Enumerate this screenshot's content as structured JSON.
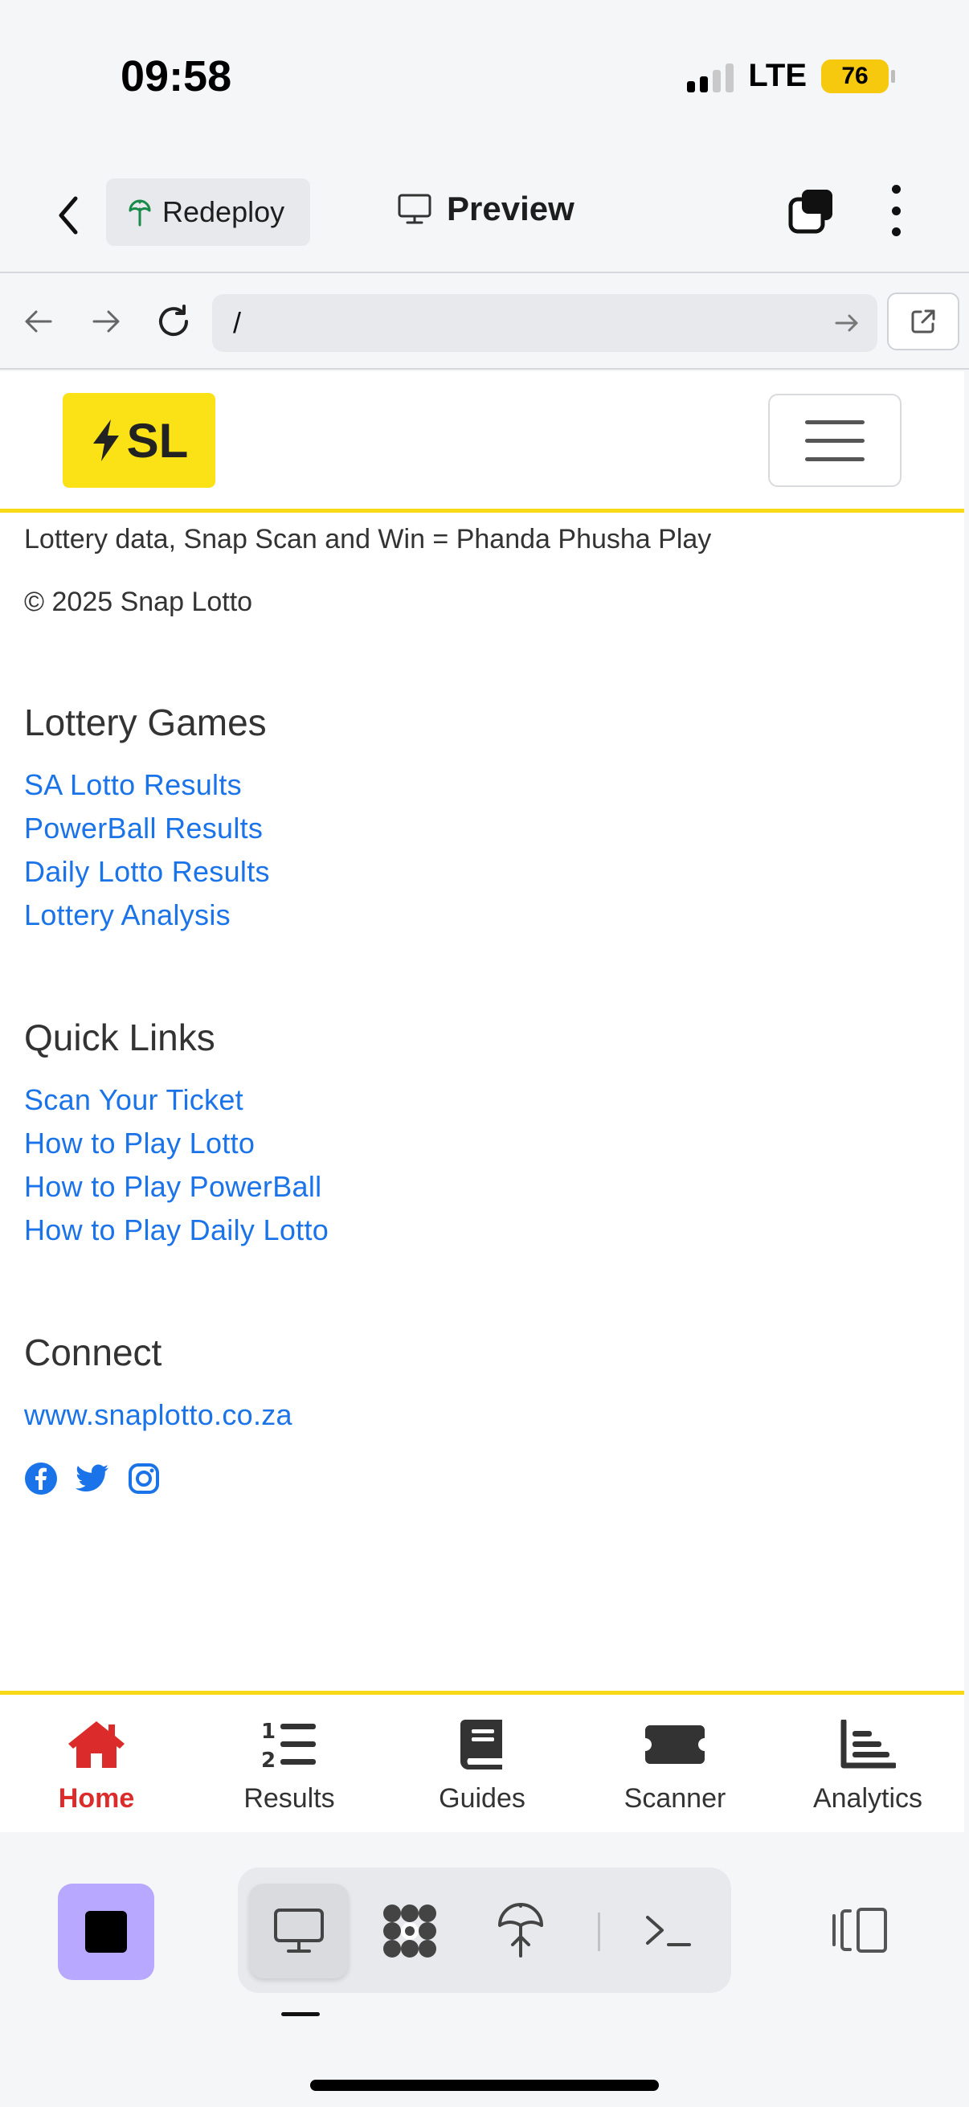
{
  "status_bar": {
    "time": "09:58",
    "network": "LTE",
    "battery": "76"
  },
  "header": {
    "redeploy_label": "Redeploy",
    "preview_label": "Preview"
  },
  "browser": {
    "url": "/"
  },
  "site": {
    "logo_text": "SL",
    "tagline": "Lottery data, Snap Scan and Win = Phanda Phusha Play",
    "copyright": "© 2025 Snap Lotto",
    "sections": [
      {
        "title": "Lottery Games",
        "links": [
          "SA Lotto Results",
          "PowerBall Results",
          "Daily Lotto Results",
          "Lottery Analysis"
        ]
      },
      {
        "title": "Quick Links",
        "links": [
          "Scan Your Ticket",
          "How to Play Lotto",
          "How to Play PowerBall",
          "How to Play Daily Lotto"
        ]
      },
      {
        "title": "Connect",
        "links": [
          "www.snaplotto.co.za"
        ]
      }
    ],
    "social_icons": [
      "facebook-icon",
      "twitter-icon",
      "instagram-icon"
    ]
  },
  "bottom_nav": [
    {
      "label": "Home",
      "icon": "home-icon",
      "active": true
    },
    {
      "label": "Results",
      "icon": "list-ordered-icon",
      "active": false
    },
    {
      "label": "Guides",
      "icon": "book-icon",
      "active": false
    },
    {
      "label": "Scanner",
      "icon": "ticket-icon",
      "active": false
    },
    {
      "label": "Analytics",
      "icon": "chart-icon",
      "active": false
    }
  ],
  "toolbar": {
    "tools": [
      "monitor-icon",
      "workflows-icon",
      "deploy-icon",
      "terminal-icon"
    ],
    "active_tool": "monitor-icon"
  },
  "colors": {
    "accent_yellow": "#f7d917",
    "link_blue": "#1a73e8",
    "active_red": "#dc2b2b",
    "stop_purple": "#b9a8ff"
  }
}
